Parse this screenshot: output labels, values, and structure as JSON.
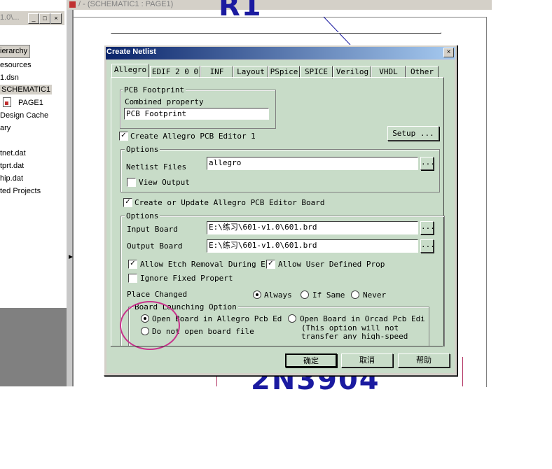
{
  "left_pane": {
    "title": "1.0\\...",
    "win_buttons": [
      "_",
      "□",
      "×"
    ],
    "tab": "ierarchy",
    "tree": [
      "esources",
      "1.dsn",
      "SCHEMATIC1",
      "PAGE1",
      "Design Cache",
      "ary",
      "tnet.dat",
      "tprt.dat",
      "hip.dat",
      "ted Projects"
    ]
  },
  "schematic": {
    "title": "/ - (SCHEMATIC1 : PAGE1)",
    "top_text": "R1",
    "bottom_text": "2N3904"
  },
  "dialog": {
    "title": "Create Netlist",
    "close": "×",
    "tabs": [
      "Allegro",
      "EDIF 2 0 0",
      "INF",
      "Layout",
      "PSpice",
      "SPICE",
      "Verilog",
      "VHDL",
      "Other"
    ],
    "pcb_footprint": {
      "group": "PCB Footprint",
      "combined_label": "Combined property",
      "combined_value": "PCB Footprint"
    },
    "create_allegro_label": "Create Allegro PCB Editor 1",
    "setup_label": "Setup ...",
    "options1": {
      "group": "Options",
      "netlist_files_label": "Netlist Files",
      "netlist_files_value": "allegro",
      "browse": "...",
      "view_output_label": "View Output"
    },
    "create_update_label": "Create or Update Allegro PCB Editor Board",
    "options2": {
      "group": "Options",
      "input_board_label": "Input Board",
      "input_board_value": "E:\\练习\\601-v1.0\\601.brd",
      "output_board_label": "Output Board",
      "output_board_value": "E:\\练习\\601-v1.0\\601.brd",
      "browse": "...",
      "allow_etch_label": "Allow Etch Removal During E",
      "allow_user_label": "Allow User Defined Prop",
      "ignore_fixed_label": "Ignore Fixed Propert",
      "place_changed_label": "Place Changed",
      "always_label": "Always",
      "if_same_label": "If Same",
      "never_label": "Never"
    },
    "launching": {
      "group": "Board Launching Option",
      "open_allegro_label": "Open Board in Allegro Pcb Ed",
      "do_not_open_label": "Do not open board file",
      "open_orcad_label": "Open Board in Orcad Pcb Edi",
      "orcad_note_1": "(This option will not",
      "orcad_note_2": "transfer any high-speed"
    },
    "ok_label": "确定",
    "cancel_label": "取消",
    "help_label": "帮助"
  },
  "colors": {
    "dialog_bg": "#c8dcc8",
    "title_start": "#0a246a",
    "annotation": "#c8328c",
    "schematic_text": "#1a1aa0"
  }
}
